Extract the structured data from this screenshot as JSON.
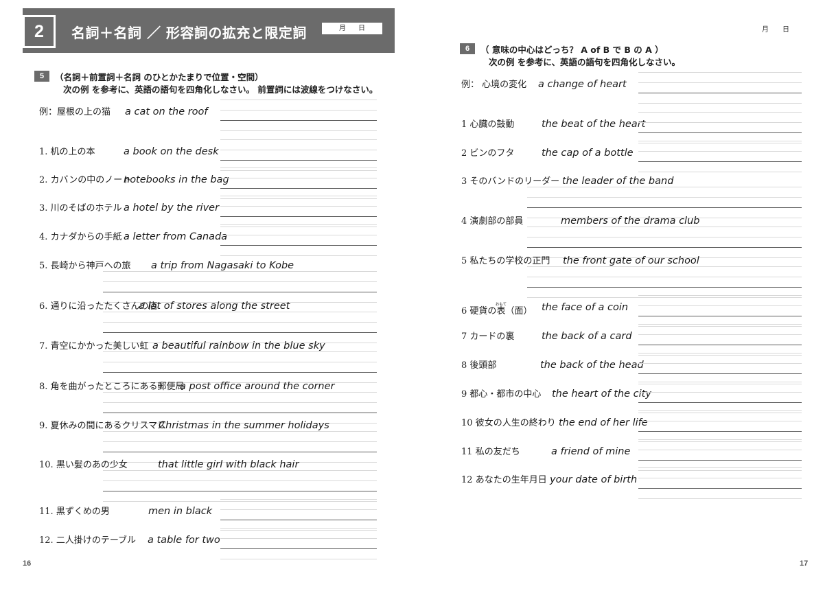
{
  "left_page": {
    "unit": {
      "number": "2",
      "title": "名詞＋名詞 ／ 形容詞の拡充と限定詞",
      "date_month": "月",
      "date_day": "日"
    },
    "section": {
      "badge": "5",
      "title": "（名詞＋前置詞＋名詞 のひとかたまりで位置・空間）",
      "instruction": "次の例 を参考に、英語の語句を四角化しなさい。 前置詞には波線をつけなさい。"
    },
    "example": {
      "jp": "例：屋根の上の猫",
      "en": "a cat on the roof"
    },
    "items": [
      {
        "no": "1.",
        "jp": "机の上の本",
        "en": "a book on the desk"
      },
      {
        "no": "2.",
        "jp": "カバンの中のノート",
        "en": "notebooks in the bag"
      },
      {
        "no": "3.",
        "jp": "川のそばのホテル",
        "en": "a hotel by the river"
      },
      {
        "no": "4.",
        "jp": "カナダからの手紙",
        "en": "a letter from Canada"
      },
      {
        "no": "5.",
        "jp": "長崎から神戸への旅",
        "en": "a trip from Nagasaki to Kobe"
      },
      {
        "no": "6.",
        "jp": "通りに沿ったたくさんの店",
        "en": "a lot of stores along the street"
      },
      {
        "no": "7.",
        "jp": "青空にかかった美しい虹",
        "en": "a beautiful rainbow in the blue sky"
      },
      {
        "no": "8.",
        "jp": "角を曲がったところにある郵便局",
        "en": "a post office around the corner"
      },
      {
        "no": "9.",
        "jp": "夏休みの間にあるクリスマス",
        "en": "Christmas in the summer holidays"
      },
      {
        "no": "10.",
        "jp": "黒い髪のあの少女",
        "en": "that little girl with black hair"
      },
      {
        "no": "11.",
        "jp": "黒ずくめの男",
        "en": "men in black"
      },
      {
        "no": "12.",
        "jp": "二人掛けのテーブル",
        "en": "a table for two"
      }
    ],
    "folio": "16"
  },
  "right_page": {
    "date_month": "月",
    "date_day": "日",
    "section": {
      "badge": "6",
      "title": "（ 意味の中心はどっち？ A of B で B の A ）",
      "instruction": "次の例 を参考に、英語の語句を四角化しなさい。"
    },
    "example": {
      "jp": "例： 心境の変化",
      "en": "a change of heart"
    },
    "items": [
      {
        "no": "1",
        "jp": "心臓の鼓動",
        "en": "the beat of the heart"
      },
      {
        "no": "2",
        "jp": "ビンのフタ",
        "en": "the cap of a bottle"
      },
      {
        "no": "3",
        "jp": "そのバンドのリーダー",
        "en": "the leader of the band"
      },
      {
        "no": "4",
        "jp": "演劇部の部員",
        "en": "members of the drama club"
      },
      {
        "no": "5",
        "jp": "私たちの学校の正門",
        "en": "the front gate of our school"
      },
      {
        "no": "6",
        "jp": "硬貨の表（面）",
        "jp_ruby_base": "表",
        "jp_ruby_text": "おもて",
        "jp_pre": "硬貨の",
        "jp_post": "（面）",
        "en": "the face of a coin"
      },
      {
        "no": "7",
        "jp": "カードの裏",
        "en": "the back of a card"
      },
      {
        "no": "8",
        "jp": "後頭部",
        "en": "the back of the head"
      },
      {
        "no": "9",
        "jp": "都心・都市の中心",
        "en": "the heart of the city"
      },
      {
        "no": "10",
        "jp": "彼女の人生の終わり",
        "en": "the end of her life"
      },
      {
        "no": "11",
        "jp": "私の友だち",
        "en": "a friend of mine"
      },
      {
        "no": "12",
        "jp": "あなたの生年月日",
        "en": "your date of birth"
      }
    ],
    "folio": "17"
  }
}
